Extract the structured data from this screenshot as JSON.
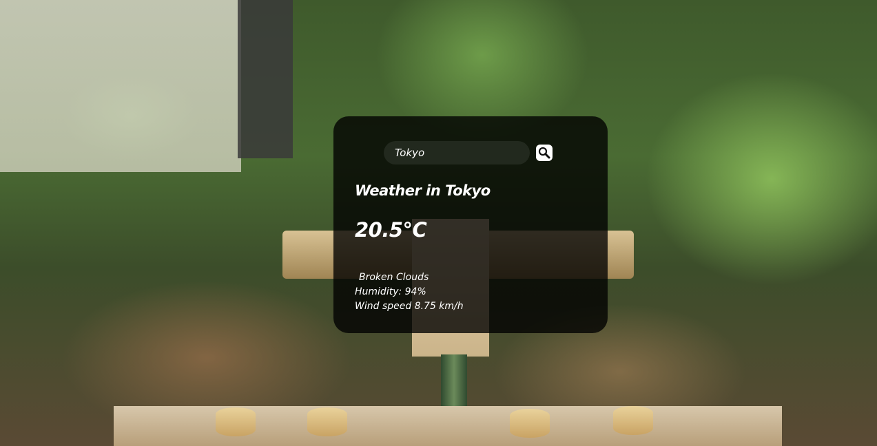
{
  "search": {
    "value": "Tokyo",
    "placeholder": "Search",
    "icon": "search-icon"
  },
  "weather": {
    "title": "Weather in Tokyo",
    "temperature": "20.5°C",
    "description": "Broken Clouds",
    "humidity": "Humidity: 94%",
    "wind": "Wind speed 8.75 km/h"
  },
  "colors": {
    "card_background": "#000000",
    "text": "#ffffff"
  }
}
